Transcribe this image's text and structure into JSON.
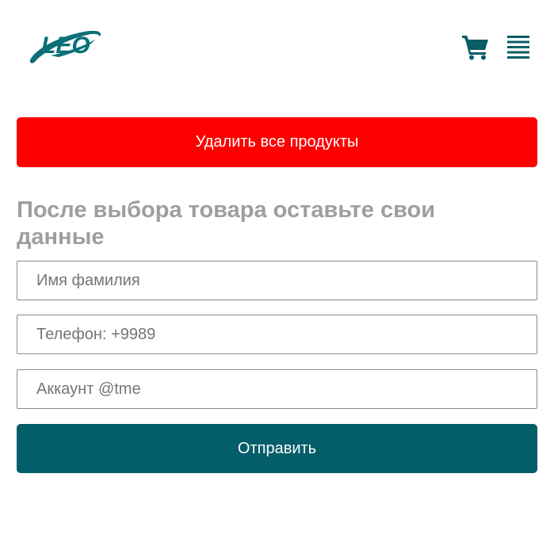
{
  "header": {
    "logo_text": "LEO",
    "cart_icon": "shopping-cart-icon",
    "menu_icon": "hamburger-menu-icon"
  },
  "actions": {
    "delete_all_label": "Удалить все продукты"
  },
  "form": {
    "title": "После выбора товара оставьте свои данные",
    "name_placeholder": "Имя фамилия",
    "phone_placeholder": "Телефон: +9989",
    "account_placeholder": "Аккаунт @tme",
    "submit_label": "Отправить"
  },
  "colors": {
    "brand": "#035e6a",
    "danger": "#ff0000",
    "title_gray": "#9e9e9e"
  }
}
